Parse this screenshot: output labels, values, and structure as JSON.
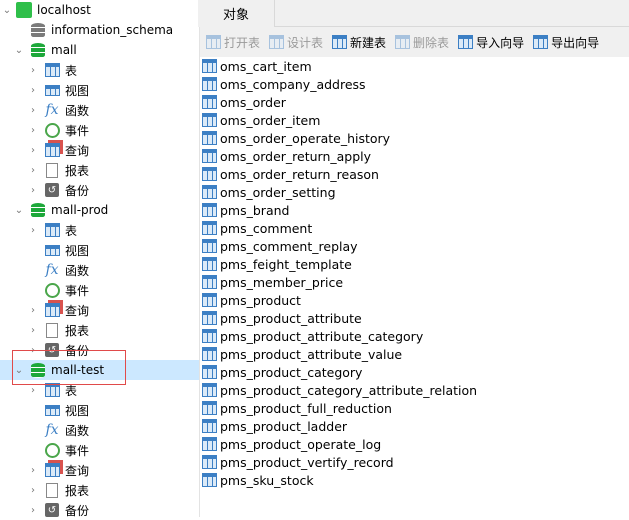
{
  "tree": {
    "server": "localhost",
    "dbs": [
      {
        "name": "information_schema"
      },
      {
        "name": "mall",
        "items": [
          "表",
          "视图",
          "函数",
          "事件",
          "查询",
          "报表",
          "备份"
        ]
      },
      {
        "name": "mall-prod",
        "items": [
          "表",
          "视图",
          "函数",
          "事件",
          "查询",
          "报表",
          "备份"
        ]
      },
      {
        "name": "mall-test",
        "items": [
          "表",
          "视图",
          "函数",
          "事件",
          "查询",
          "报表",
          "备份"
        ]
      }
    ]
  },
  "tab": "对象",
  "toolbar": {
    "open": "打开表",
    "design": "设计表",
    "new": "新建表",
    "delete": "删除表",
    "import": "导入向导",
    "export": "导出向导"
  },
  "tables": [
    "oms_cart_item",
    "oms_company_address",
    "oms_order",
    "oms_order_item",
    "oms_order_operate_history",
    "oms_order_return_apply",
    "oms_order_return_reason",
    "oms_order_setting",
    "pms_brand",
    "pms_comment",
    "pms_comment_replay",
    "pms_feight_template",
    "pms_member_price",
    "pms_product",
    "pms_product_attribute",
    "pms_product_attribute_category",
    "pms_product_attribute_value",
    "pms_product_category",
    "pms_product_category_attribute_relation",
    "pms_product_full_reduction",
    "pms_product_ladder",
    "pms_product_operate_log",
    "pms_product_vertify_record",
    "pms_sku_stock"
  ],
  "colors": {
    "selection": "#cce8ff",
    "highlight_box": "#e04a4a",
    "db_green": "#1da83a"
  }
}
